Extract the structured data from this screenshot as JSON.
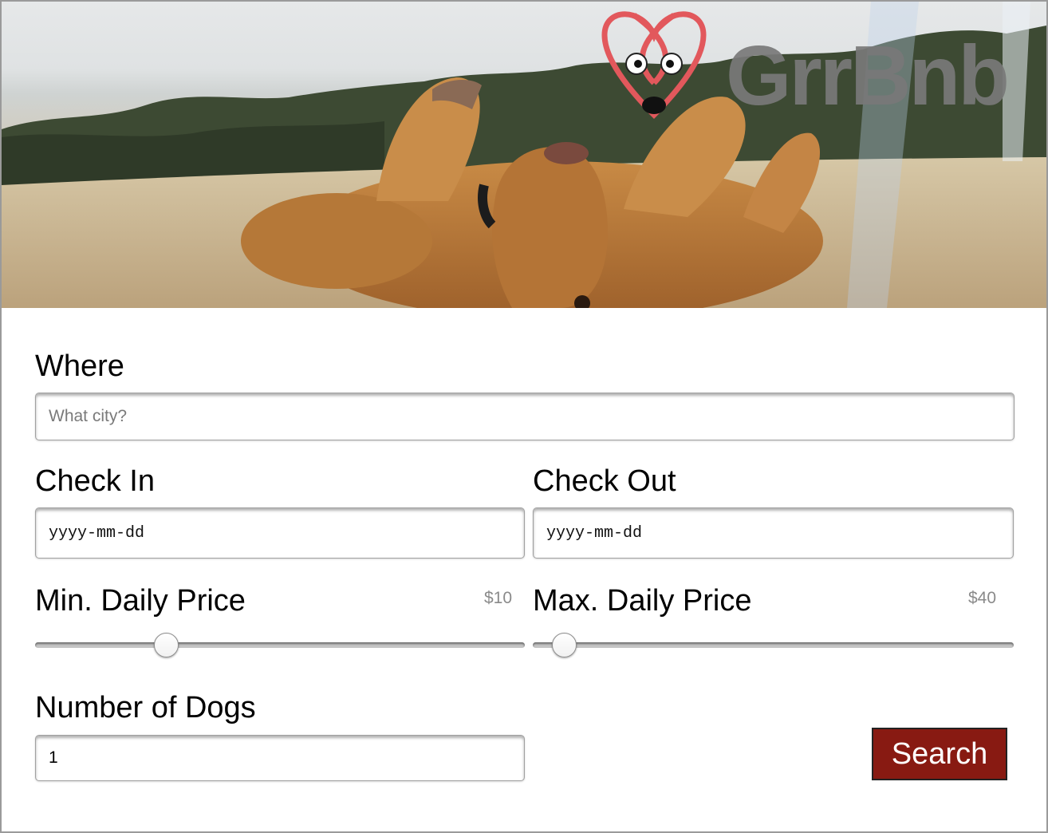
{
  "brand": {
    "name": "GrrBnb",
    "logo_icon": "dog-heart-logo-icon",
    "accent_color": "#e2585c"
  },
  "hero": {
    "image": "dog-rolling-in-grass"
  },
  "form": {
    "where": {
      "label": "Where",
      "placeholder": "What city?",
      "value": ""
    },
    "check_in": {
      "label": "Check In",
      "placeholder": "yyyy-mm-dd"
    },
    "check_out": {
      "label": "Check Out",
      "placeholder": "yyyy-mm-dd"
    },
    "min_price": {
      "label": "Min. Daily Price",
      "value_text": "$10",
      "value": 10,
      "fraction": 0.255
    },
    "max_price": {
      "label": "Max. Daily Price",
      "value_text": "$40",
      "value": 40,
      "fraction": 0.042
    },
    "dogs": {
      "label": "Number of Dogs",
      "value": "1"
    },
    "search_button": {
      "label": "Search",
      "color": "#881a12"
    }
  }
}
